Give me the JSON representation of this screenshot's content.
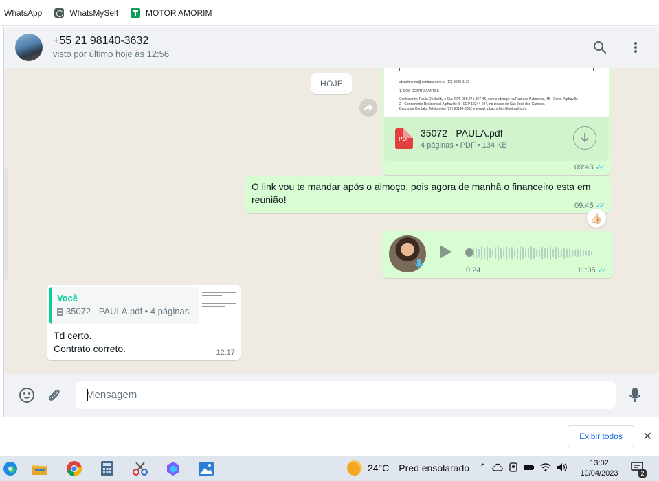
{
  "bookmarks": [
    {
      "label": "WhatsApp"
    },
    {
      "label": "WhatsMySelf"
    },
    {
      "label": "MOTOR AMORIM"
    }
  ],
  "header": {
    "contact_name": "+55 21 98140-3632",
    "status": "visto por último hoje às 12:56"
  },
  "chat": {
    "date_pill": "HOJE",
    "pdf_message": {
      "preview_lines": [
        "atendimento@contrato.com.br                                              (12) 3939-1110",
        "1. DOS CONTRATANTES",
        "Contratante: Paula Decholdy e Cia. CPF 059.271.267-46, com endereço na Rua das Palmeiras, 45 - Cond. Alphaville",
        "2 - Condomínio Residencial Alphaville II - CEP 12244-044, na cidade de São José dos Campos.",
        "Dados de Contato: Telefone(s) (21) 98140-3632 e e-mail: pbachofsky@hotmail.com"
      ],
      "icon_label": "PDF",
      "file_name": "35072 - PAULA.pdf",
      "file_info": "4 páginas • PDF • 134 KB",
      "time": "09:43"
    },
    "text_message": {
      "text": "O link vou te mandar após o almoço, pois agora de manhã o financeiro esta em reunião!",
      "time": "09:45",
      "reaction": "👍🏻"
    },
    "voice_message": {
      "duration": "0:24",
      "time": "11:05",
      "progress": 0
    },
    "reply_message": {
      "quote_author": "Você",
      "quote_text": "35072 - PAULA.pdf • 4 páginas",
      "lines": [
        "Td certo.",
        "Contrato correto."
      ],
      "time": "12:17"
    }
  },
  "composer": {
    "placeholder": "Mensagem"
  },
  "download_bar": {
    "show_all_label": "Exibir todos",
    "close_label": "✕"
  },
  "taskbar": {
    "weather_temp": "24°C",
    "weather_text": "Pred ensolarado",
    "time": "13:02",
    "date": "10/04/2023",
    "notification_count": "2"
  },
  "colors": {
    "outgoing_bubble": "#d9fdd3",
    "incoming_bubble": "#ffffff",
    "chat_background": "#efeae2",
    "accent_green": "#06cf9c",
    "read_ticks": "#53bdeb",
    "pdf_red": "#e53e3e"
  },
  "icons": {
    "bookmark_whatsmyself": "whatsmyself-icon",
    "bookmark_motor": "sheets-icon",
    "search": "search-icon",
    "menu": "kebab-menu-icon",
    "forward": "forward-icon",
    "download": "download-icon",
    "play": "play-icon",
    "mic": "mic-icon",
    "emoji": "emoji-icon",
    "attach": "paperclip-icon"
  }
}
